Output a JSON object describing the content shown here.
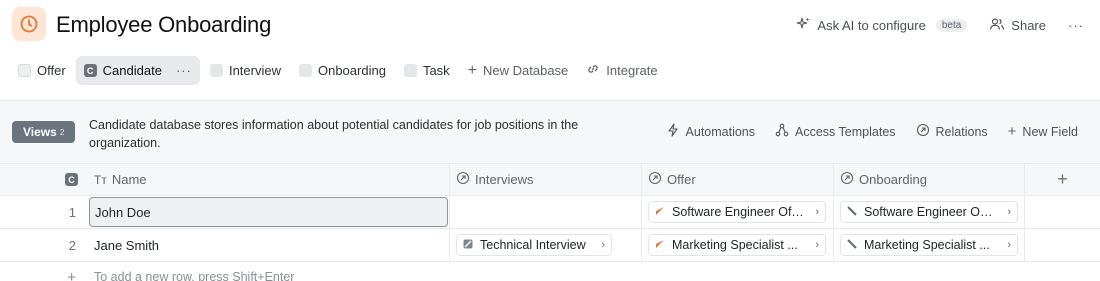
{
  "header": {
    "title": "Employee Onboarding",
    "ask_ai_label": "Ask AI to configure",
    "beta_badge": "beta",
    "share_label": "Share",
    "more_label": "···"
  },
  "tabs": [
    {
      "label": "Offer",
      "badge": ""
    },
    {
      "label": "Candidate",
      "badge": "C",
      "more": "···"
    },
    {
      "label": "Interview",
      "badge": ""
    },
    {
      "label": "Onboarding",
      "badge": ""
    },
    {
      "label": "Task",
      "badge": ""
    },
    {
      "label": "New Database"
    },
    {
      "label": "Integrate"
    }
  ],
  "toolbar": {
    "views_label": "Views",
    "views_count": "2",
    "description": "Candidate database stores information about potential candidates for job positions in the organization.",
    "automations_label": "Automations",
    "access_templates_label": "Access Templates",
    "relations_label": "Relations",
    "new_field_label": "New Field"
  },
  "table": {
    "index_badge": "C",
    "columns": {
      "name": "Name",
      "interviews": "Interviews",
      "offer": "Offer",
      "onboarding": "Onboarding",
      "add": "+"
    },
    "rows": [
      {
        "index": "1",
        "name": "John Doe",
        "interview": "",
        "offer": "Software Engineer Offer",
        "onboarding": "Software Engineer On..."
      },
      {
        "index": "2",
        "name": "Jane Smith",
        "interview": "Technical Interview",
        "offer": "Marketing Specialist ...",
        "onboarding": "Marketing Specialist ..."
      }
    ],
    "add_row_hint": "To add a new row, press Shift+Enter",
    "add_row_icon": "+"
  },
  "colors": {
    "accent_orange": "#e07a3a",
    "views_bg": "#6b737d",
    "header_icon_bg": "#fde6d6"
  }
}
